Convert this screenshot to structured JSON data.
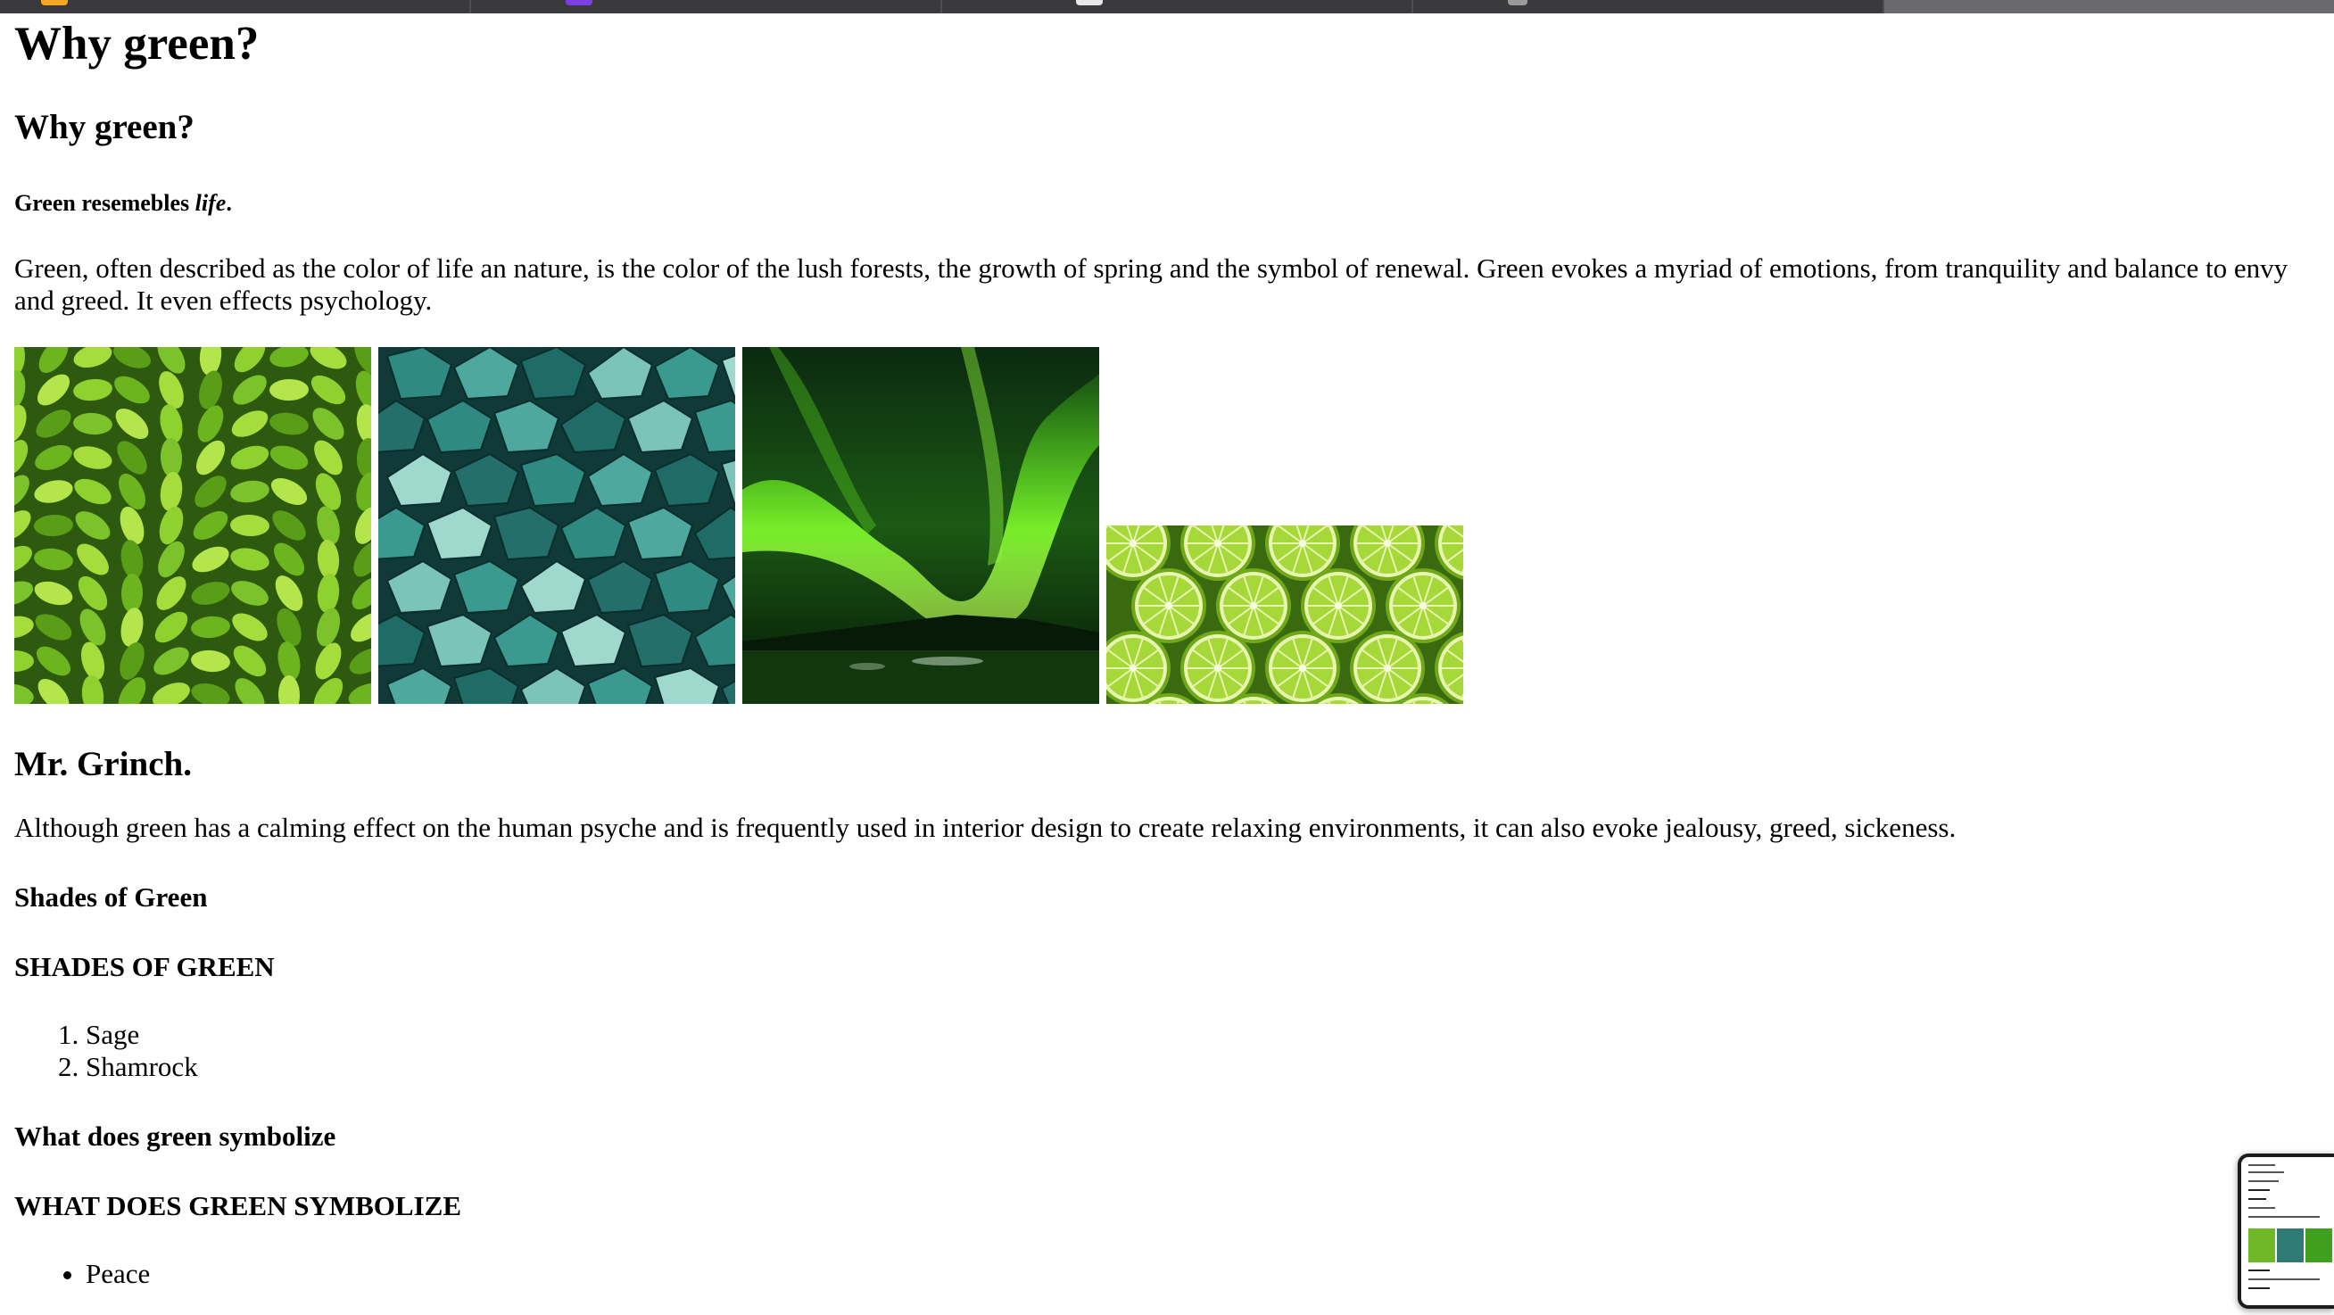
{
  "tabs": [
    {
      "favicon_color": "#f5a623"
    },
    {
      "favicon_color": "#7b3fe4"
    },
    {
      "favicon_color": "#e8e8e8"
    },
    {
      "favicon_color": "#9a9a9a"
    },
    {
      "favicon_color": ""
    }
  ],
  "page": {
    "h1": "Why green?",
    "h2": "Why green?",
    "tagline_prefix": "Green resemebles ",
    "tagline_emph": "life",
    "tagline_suffix": ".",
    "intro": "Green, often described as the color of life an nature, is the color of the lush forests, the growth of spring and the symbol of renewal. Green evokes a myriad of emotions, from tranquility and balance to envy and greed. It even effects psychology.",
    "images": [
      "leaves-image",
      "green-glass-rocks-image",
      "aurora-image",
      "lime-slices-image"
    ],
    "grinch_heading": "Mr. Grinch.",
    "grinch_text": "Although green has a calming effect on the human psyche and is frequently used in interior design to create relaxing environments, it can also evoke jealousy, greed, sickeness.",
    "shades_heading": "Shades of Green",
    "shades_heading_upper": "SHADES OF GREEN",
    "shades": [
      "Sage",
      "Shamrock"
    ],
    "symbolize_heading": "What does green symbolize",
    "symbolize_heading_upper": "WHAT DOES GREEN SYMBOLIZE",
    "symbols": [
      "Peace"
    ]
  },
  "colors": {
    "leaf": "#7cc22a",
    "glass": "#2f8a82",
    "aurora": "#5fe01f",
    "lime": "#9ed23a"
  }
}
